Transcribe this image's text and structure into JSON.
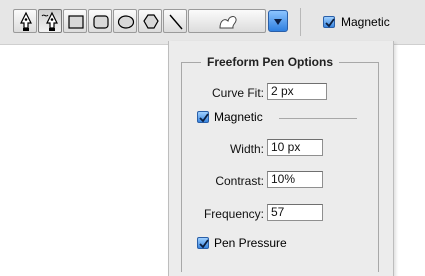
{
  "toolbar": {
    "tools": [
      {
        "name": "pen-tool-icon"
      },
      {
        "name": "freeform-pen-tool-icon",
        "pressed": true
      },
      {
        "name": "rectangle-tool-icon"
      },
      {
        "name": "rounded-rectangle-tool-icon"
      },
      {
        "name": "ellipse-tool-icon"
      },
      {
        "name": "polygon-tool-icon"
      },
      {
        "name": "line-tool-icon"
      },
      {
        "name": "custom-shape-tool-icon"
      }
    ],
    "dropdown_icon": "chevron-down-icon",
    "magnetic_label": "Magnetic",
    "magnetic_checked": true
  },
  "panel": {
    "title": "Freeform Pen Options",
    "curve_fit": {
      "label": "Curve Fit:",
      "value": "2 px"
    },
    "magnetic": {
      "label": "Magnetic",
      "checked": true
    },
    "width": {
      "label": "Width:",
      "value": "10 px"
    },
    "contrast": {
      "label": "Contrast:",
      "value": "10%"
    },
    "frequency": {
      "label": "Frequency:",
      "value": "57"
    },
    "pen_pressure": {
      "label": "Pen Pressure",
      "checked": true
    }
  },
  "colors": {
    "accent": "#3a86e0",
    "panel_bg": "#ececec",
    "toolbar_bg": "#e6e6e6"
  }
}
